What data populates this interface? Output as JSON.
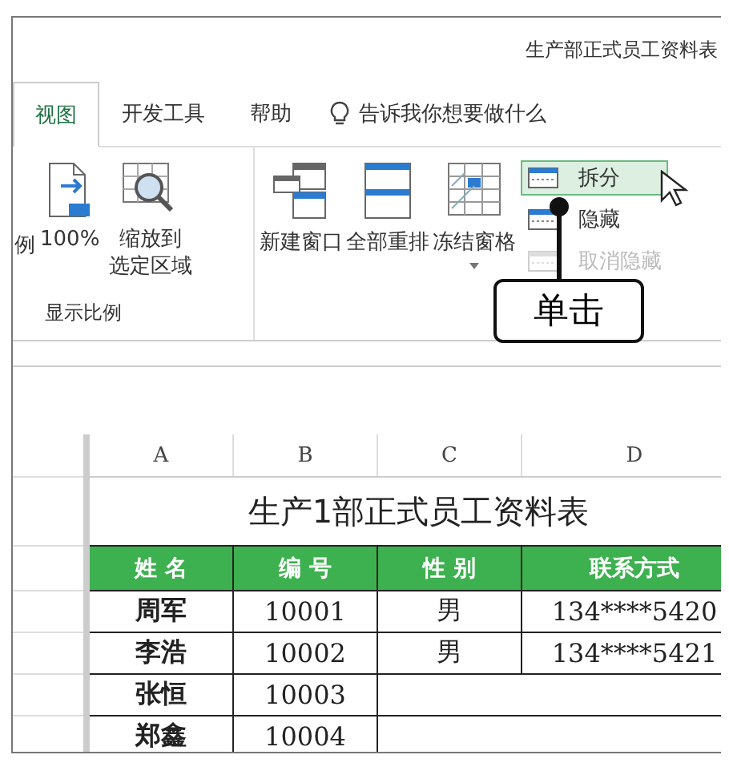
{
  "window": {
    "title": "生产部正式员工资料表"
  },
  "tabs": [
    {
      "label": "视图",
      "selected": true
    },
    {
      "label": "开发工具",
      "selected": false
    },
    {
      "label": "帮助",
      "selected": false
    }
  ],
  "tell_me": {
    "placeholder": "告诉我你想要做什么"
  },
  "zoom_group": {
    "cut_label": "例",
    "label": "显示比例",
    "buttons": [
      {
        "kind": "page100",
        "lines": [
          "100%"
        ]
      },
      {
        "kind": "zoomsel",
        "lines": [
          "缩放到",
          "选定区域"
        ]
      }
    ]
  },
  "window_group": {
    "buttons": [
      {
        "kind": "newwin",
        "label": "新建窗口",
        "dropdown": false
      },
      {
        "kind": "arrange",
        "label": "全部重排",
        "dropdown": false
      },
      {
        "kind": "freeze",
        "label": "冻结窗格",
        "dropdown": true
      }
    ],
    "small_buttons": [
      {
        "label": "拆分",
        "hovered": true,
        "disabled": false
      },
      {
        "label": "隐藏",
        "hovered": false,
        "disabled": false
      },
      {
        "label": "取消隐藏",
        "hovered": false,
        "disabled": true
      }
    ]
  },
  "callout": {
    "text": "单击"
  },
  "sheet": {
    "columns": [
      "A",
      "B",
      "C",
      "D"
    ],
    "title": "生产1部正式员工资料表",
    "headers": [
      "姓 名",
      "编 号",
      "性 别",
      "联系方式"
    ],
    "rows": [
      [
        "周军",
        "10001",
        "男",
        "134****5420"
      ],
      [
        "李浩",
        "10002",
        "男",
        "134****5421"
      ],
      [
        "张恒",
        "10003"
      ],
      [
        "郑鑫",
        "10004"
      ]
    ]
  }
}
